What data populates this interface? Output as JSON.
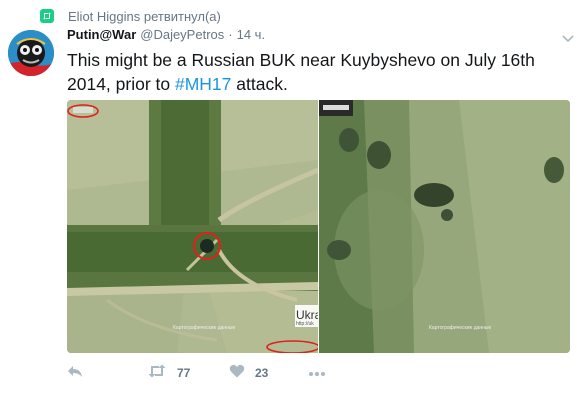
{
  "retweet_context": {
    "text": "Eliot Higgins ретвитнул(а)",
    "icon": "retweet-icon"
  },
  "tweet": {
    "author_name": "Putin@War",
    "author_handle": "@DajeyPetros",
    "separator": "·",
    "time": "14 ч.",
    "text_before": "This might be a Russian BUK near Kuybyshevo on July 16th 2014, prior to ",
    "hashtag": "#MH17",
    "text_after": " attack."
  },
  "media": {
    "left_watermark": "Картографические данные",
    "left_url_label": "Ukra",
    "left_url_sub": "http://uk",
    "right_watermark": "Картографические данные"
  },
  "actions": {
    "reply_icon": "reply-icon",
    "retweet_icon": "retweet-icon",
    "retweet_count": "77",
    "like_icon": "heart-icon",
    "like_count": "23",
    "more_icon": "more-dots-icon"
  },
  "colors": {
    "retweet_green": "#19cf86",
    "hashtag_blue": "#1b95e0",
    "secondary_text": "#657786",
    "annotation_red": "#e0201b"
  }
}
